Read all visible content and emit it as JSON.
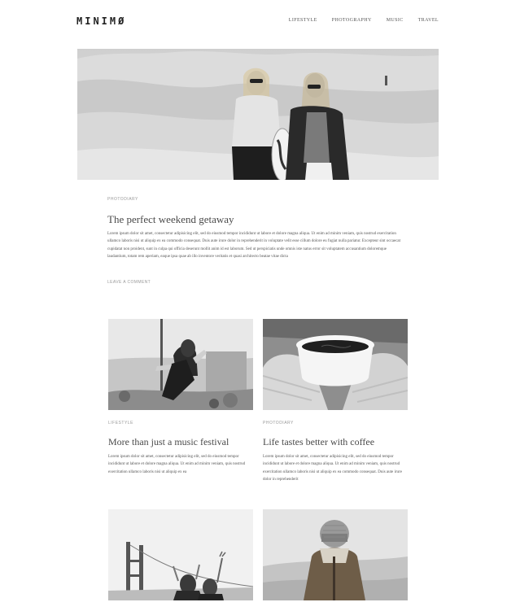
{
  "header": {
    "logo": "MINIMØ",
    "nav": [
      "LIFESTYLE",
      "PHOTOGRAPHY",
      "MUSIC",
      "TRAVEL"
    ]
  },
  "featured": {
    "category": "PHOTODIARY",
    "title": "The perfect weekend getaway",
    "excerpt": "Lorem ipsum dolor sit amet, consectetur adipisicing elit, sed do eiusmod tempor incididunt ut labore et dolore magna aliqua. Ut enim ad minim veniam, quis nostrud exercitation ullamco laboris nisi ut aliquip ex ea commodo consequat. Duis aute irure dolor in reprehenderit in voluptate velit esse cillum dolore eu fugiat nulla pariatur. Excepteur sint occaecat cupidatat non proident, sunt in culpa qui officia deserunt mollit anim id est laborum. Sed ut perspiciatis unde omnis iste natus error sit voluptatem accusantium doloremque laudantium, totam rem aperiam, eaque ipsa quae ab illo inventore veritatis et quasi architecto beatae vitae dicta",
    "comment_link": "LEAVE A COMMENT"
  },
  "posts": [
    {
      "category": "LIFESTYLE",
      "title": "More than just a music festival",
      "excerpt": "Lorem ipsum dolor sit amet, consectetur adipisicing elit, sed do eiusmod tempor incididunt ut labore et dolore magna aliqua. Ut enim ad minim veniam, quis nostrud exercitation ullamco laboris nisi ut aliquip ex ea"
    },
    {
      "category": "PHOTODIARY",
      "title": "Life tastes better with coffee",
      "excerpt": "Lorem ipsum dolor sit amet, consectetur adipisicing elit, sed do eiusmod tempor incididunt ut labore et dolore magna aliqua. Ut enim ad minim veniam, quis nostrud exercitation ullamco laboris nisi ut aliquip ex ea commodo consequat. Duis aute irure dolor in reprehenderit"
    }
  ]
}
